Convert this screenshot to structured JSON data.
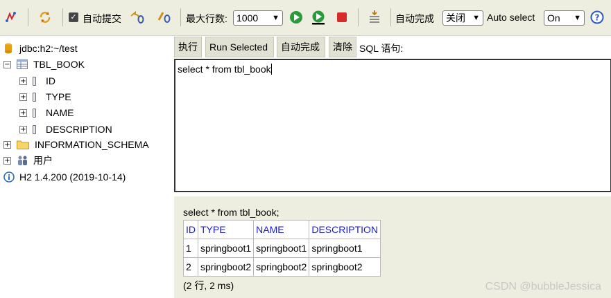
{
  "toolbar": {
    "auto_commit_label": "自动提交",
    "max_rows_label": "最大行数:",
    "max_rows_value": "1000",
    "auto_complete_label": "自动完成",
    "auto_complete_value": "关闭",
    "auto_select_label": "Auto select",
    "auto_select_value": "On"
  },
  "tree": {
    "connection": "jdbc:h2:~/test",
    "table": "TBL_BOOK",
    "columns": [
      "ID",
      "TYPE",
      "NAME",
      "DESCRIPTION"
    ],
    "schema": "INFORMATION_SCHEMA",
    "users": "用户",
    "version": "H2 1.4.200 (2019-10-14)"
  },
  "buttons": {
    "run": "执行",
    "run_selected": "Run Selected",
    "auto_complete": "自动完成",
    "clear": "清除",
    "sql_label": "SQL 语句:"
  },
  "editor": {
    "text": "select * from tbl_book"
  },
  "result": {
    "query": "select * from tbl_book;",
    "headers": [
      "ID",
      "TYPE",
      "NAME",
      "DESCRIPTION"
    ],
    "rows": [
      [
        "1",
        "springboot1",
        "springboot1",
        "springboot1"
      ],
      [
        "2",
        "springboot2",
        "springboot2",
        "springboot2"
      ]
    ],
    "stats": "(2 行, 2 ms)"
  },
  "watermark": "CSDN @bubbleJessica"
}
